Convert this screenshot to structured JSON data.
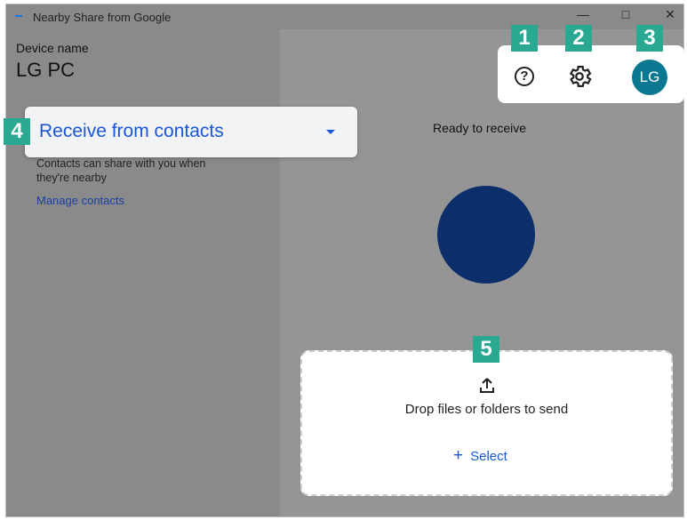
{
  "window": {
    "title": "Nearby Share from Google",
    "minimize": "—",
    "maximize": "□",
    "close": "✕"
  },
  "sidebar": {
    "device_label": "Device name",
    "device_name": "LG PC",
    "receive_option": "Receive from contacts",
    "receive_description": "Contacts can share with you when they're nearby",
    "manage_link": "Manage contacts"
  },
  "toolbar": {
    "help_icon": "question-circle-icon",
    "help_glyph": "?",
    "settings_icon": "gear-icon",
    "avatar_initials": "LG"
  },
  "main": {
    "status": "Ready to receive",
    "drop_text": "Drop files or folders to send",
    "select_plus": "+",
    "select_label": "Select"
  },
  "callouts": [
    "1",
    "2",
    "3",
    "4",
    "5"
  ],
  "colors": {
    "accent_blue": "#1a56d6",
    "callout_teal": "#2aa891",
    "avatar_teal": "#0a7890",
    "receive_circle": "#0c2e6b"
  }
}
